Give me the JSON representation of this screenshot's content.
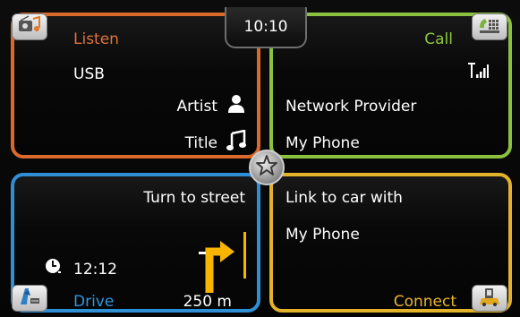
{
  "clock": {
    "time": "10:10"
  },
  "listen": {
    "title": "Listen",
    "source": "USB",
    "artist_label": "Artist",
    "title_label": "Title",
    "accent": "#d96a2b",
    "corner_icon": "radio-music-icon"
  },
  "call": {
    "title": "Call",
    "provider": "Network Provider",
    "phone": "My Phone",
    "accent": "#8bc13f",
    "corner_icon": "phone-keypad-icon",
    "status_icon": "signal-strength-icon"
  },
  "drive": {
    "title": "Drive",
    "instruction": "Turn to street",
    "arrival_time": "12:12",
    "distance": "250 m",
    "accent": "#2f8fd4",
    "corner_icon": "navigation-icon"
  },
  "connect": {
    "line1": "Link to car with",
    "line2": "My Phone",
    "title": "Connect",
    "accent": "#e2b22a",
    "corner_icon": "phone-car-icon"
  },
  "favorites": {
    "icon": "star-icon"
  }
}
